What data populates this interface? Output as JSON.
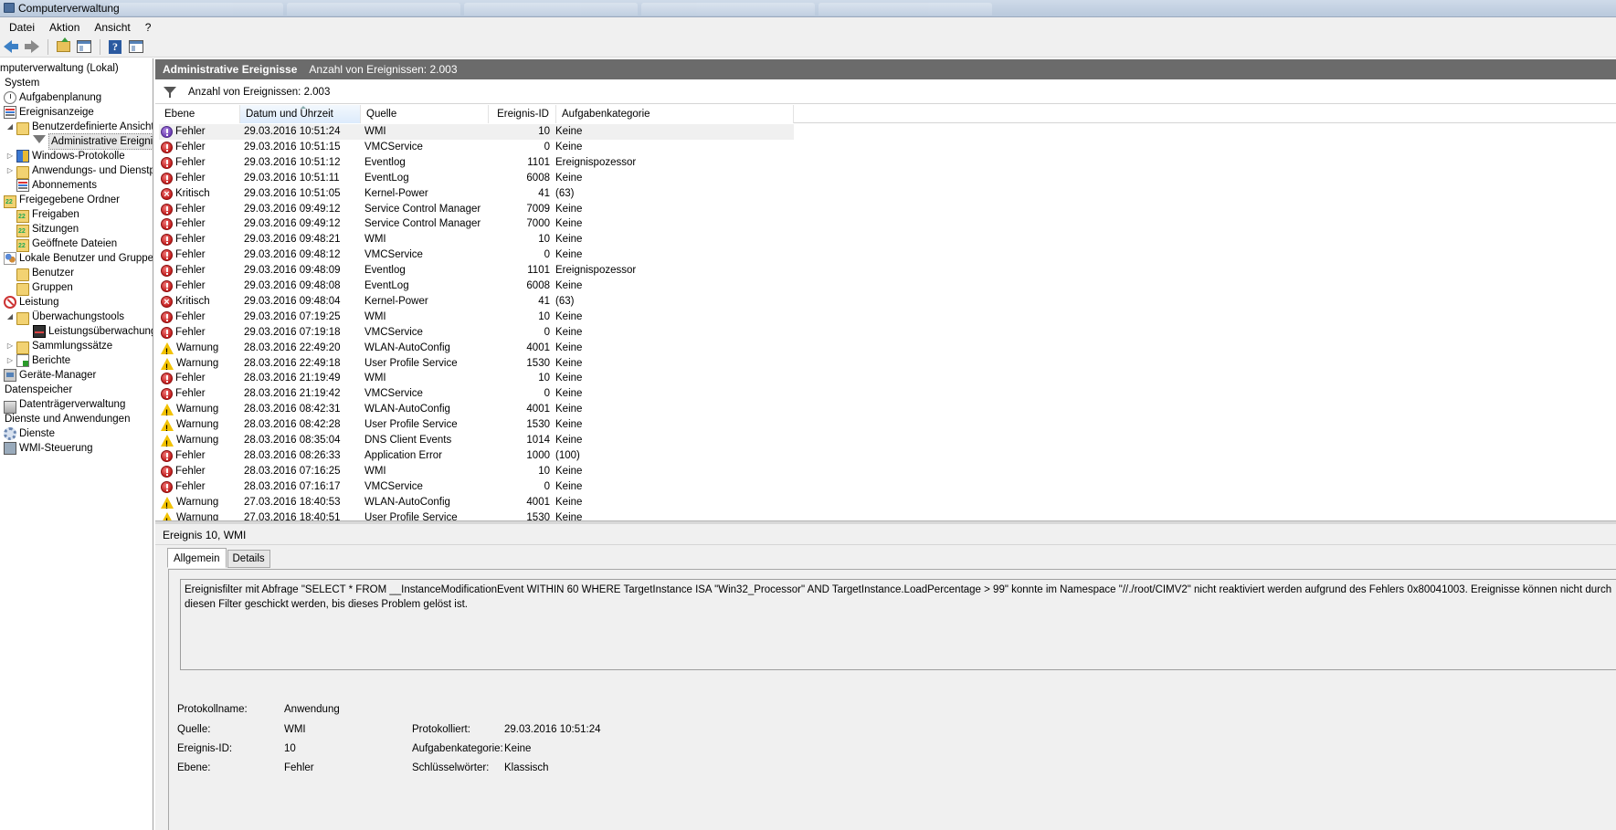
{
  "window": {
    "title": "Computerverwaltung"
  },
  "menu": {
    "items": [
      "Datei",
      "Aktion",
      "Ansicht",
      "?"
    ]
  },
  "toolbar": {
    "buttons": [
      "back-arrow-icon",
      "forward-arrow-icon",
      "folder-up-icon",
      "show-hide-tree-icon",
      "help-icon",
      "action-pane-icon"
    ]
  },
  "tree": {
    "items": [
      "mputerverwaltung (Lokal)",
      "System",
      "Aufgabenplanung",
      "Ereignisanzeige",
      "Benutzerdefinierte Ansichte",
      "Administrative Ereigniss",
      "Windows-Protokolle",
      "Anwendungs- und Dienstpr",
      "Abonnements",
      "Freigegebene Ordner",
      "Freigaben",
      "Sitzungen",
      "Geöffnete Dateien",
      "Lokale Benutzer und Gruppen",
      "Benutzer",
      "Gruppen",
      "Leistung",
      "Überwachungstools",
      "Leistungsüberwachung",
      "Sammlungssätze",
      "Berichte",
      "Geräte-Manager",
      "Datenspeicher",
      "Datenträgerverwaltung",
      "Dienste und Anwendungen",
      "Dienste",
      "WMI-Steuerung"
    ]
  },
  "header": {
    "title": "Administrative Ereignisse",
    "count": "Anzahl von Ereignissen: 2.003"
  },
  "filter": {
    "text": "Anzahl von Ereignissen: 2.003"
  },
  "table": {
    "columns": [
      "Ebene",
      "Datum und Uhrzeit",
      "Quelle",
      "Ereignis-ID",
      "Aufgabenkategorie"
    ],
    "rows": [
      {
        "level": "Fehler",
        "icon": "error-purple",
        "date": "29.03.2016 10:51:24",
        "source": "WMI",
        "id": "10",
        "cat": "Keine"
      },
      {
        "level": "Fehler",
        "icon": "error",
        "date": "29.03.2016 10:51:15",
        "source": "VMCService",
        "id": "0",
        "cat": "Keine"
      },
      {
        "level": "Fehler",
        "icon": "error",
        "date": "29.03.2016 10:51:12",
        "source": "Eventlog",
        "id": "1101",
        "cat": "Ereignispozessor"
      },
      {
        "level": "Fehler",
        "icon": "error",
        "date": "29.03.2016 10:51:11",
        "source": "EventLog",
        "id": "6008",
        "cat": "Keine"
      },
      {
        "level": "Kritisch",
        "icon": "critical",
        "date": "29.03.2016 10:51:05",
        "source": "Kernel-Power",
        "id": "41",
        "cat": "(63)"
      },
      {
        "level": "Fehler",
        "icon": "error",
        "date": "29.03.2016 09:49:12",
        "source": "Service Control Manager",
        "id": "7009",
        "cat": "Keine"
      },
      {
        "level": "Fehler",
        "icon": "error",
        "date": "29.03.2016 09:49:12",
        "source": "Service Control Manager",
        "id": "7000",
        "cat": "Keine"
      },
      {
        "level": "Fehler",
        "icon": "error",
        "date": "29.03.2016 09:48:21",
        "source": "WMI",
        "id": "10",
        "cat": "Keine"
      },
      {
        "level": "Fehler",
        "icon": "error",
        "date": "29.03.2016 09:48:12",
        "source": "VMCService",
        "id": "0",
        "cat": "Keine"
      },
      {
        "level": "Fehler",
        "icon": "error",
        "date": "29.03.2016 09:48:09",
        "source": "Eventlog",
        "id": "1101",
        "cat": "Ereignispozessor"
      },
      {
        "level": "Fehler",
        "icon": "error",
        "date": "29.03.2016 09:48:08",
        "source": "EventLog",
        "id": "6008",
        "cat": "Keine"
      },
      {
        "level": "Kritisch",
        "icon": "critical",
        "date": "29.03.2016 09:48:04",
        "source": "Kernel-Power",
        "id": "41",
        "cat": "(63)"
      },
      {
        "level": "Fehler",
        "icon": "error",
        "date": "29.03.2016 07:19:25",
        "source": "WMI",
        "id": "10",
        "cat": "Keine"
      },
      {
        "level": "Fehler",
        "icon": "error",
        "date": "29.03.2016 07:19:18",
        "source": "VMCService",
        "id": "0",
        "cat": "Keine"
      },
      {
        "level": "Warnung",
        "icon": "warning",
        "date": "28.03.2016 22:49:20",
        "source": "WLAN-AutoConfig",
        "id": "4001",
        "cat": "Keine"
      },
      {
        "level": "Warnung",
        "icon": "warning",
        "date": "28.03.2016 22:49:18",
        "source": "User Profile Service",
        "id": "1530",
        "cat": "Keine"
      },
      {
        "level": "Fehler",
        "icon": "error",
        "date": "28.03.2016 21:19:49",
        "source": "WMI",
        "id": "10",
        "cat": "Keine"
      },
      {
        "level": "Fehler",
        "icon": "error",
        "date": "28.03.2016 21:19:42",
        "source": "VMCService",
        "id": "0",
        "cat": "Keine"
      },
      {
        "level": "Warnung",
        "icon": "warning",
        "date": "28.03.2016 08:42:31",
        "source": "WLAN-AutoConfig",
        "id": "4001",
        "cat": "Keine"
      },
      {
        "level": "Warnung",
        "icon": "warning",
        "date": "28.03.2016 08:42:28",
        "source": "User Profile Service",
        "id": "1530",
        "cat": "Keine"
      },
      {
        "level": "Warnung",
        "icon": "warning",
        "date": "28.03.2016 08:35:04",
        "source": "DNS Client Events",
        "id": "1014",
        "cat": "Keine"
      },
      {
        "level": "Fehler",
        "icon": "error",
        "date": "28.03.2016 08:26:33",
        "source": "Application Error",
        "id": "1000",
        "cat": "(100)"
      },
      {
        "level": "Fehler",
        "icon": "error",
        "date": "28.03.2016 07:16:25",
        "source": "WMI",
        "id": "10",
        "cat": "Keine"
      },
      {
        "level": "Fehler",
        "icon": "error",
        "date": "28.03.2016 07:16:17",
        "source": "VMCService",
        "id": "0",
        "cat": "Keine"
      },
      {
        "level": "Warnung",
        "icon": "warning",
        "date": "27.03.2016 18:40:53",
        "source": "WLAN-AutoConfig",
        "id": "4001",
        "cat": "Keine"
      },
      {
        "level": "Warnung",
        "icon": "warning",
        "date": "27.03.2016 18:40:51",
        "source": "User Profile Service",
        "id": "1530",
        "cat": "Keine"
      }
    ]
  },
  "detail": {
    "title": "Ereignis 10, WMI",
    "tabs": [
      "Allgemein",
      "Details"
    ],
    "message": "Ereignisfilter mit Abfrage \"SELECT * FROM __InstanceModificationEvent WITHIN 60 WHERE TargetInstance ISA \"Win32_Processor\" AND TargetInstance.LoadPercentage > 99\" konnte im Namespace \"//./root/CIMV2\" nicht reaktiviert werden aufgrund des Fehlers 0x80041003. Ereignisse können nicht durch diesen Filter geschickt werden, bis dieses Problem gelöst ist.",
    "fields": {
      "protokollname_label": "Protokollname:",
      "protokollname_value": "Anwendung",
      "quelle_label": "Quelle:",
      "quelle_value": "WMI",
      "protokolliert_label": "Protokolliert:",
      "protokolliert_value": "29.03.2016 10:51:24",
      "ereignisid_label": "Ereignis-ID:",
      "ereignisid_value": "10",
      "aufgabenkategorie_label": "Aufgabenkategorie:",
      "aufgabenkategorie_value": "Keine",
      "ebene_label": "Ebene:",
      "ebene_value": "Fehler",
      "schluessel_label": "Schlüsselwörter:",
      "schluessel_value": "Klassisch"
    }
  },
  "colors": {
    "header_strip": "#6b6b6b",
    "error": "#c11b1b",
    "warning": "#f2c200",
    "selected_row": "#f0f0f0"
  }
}
